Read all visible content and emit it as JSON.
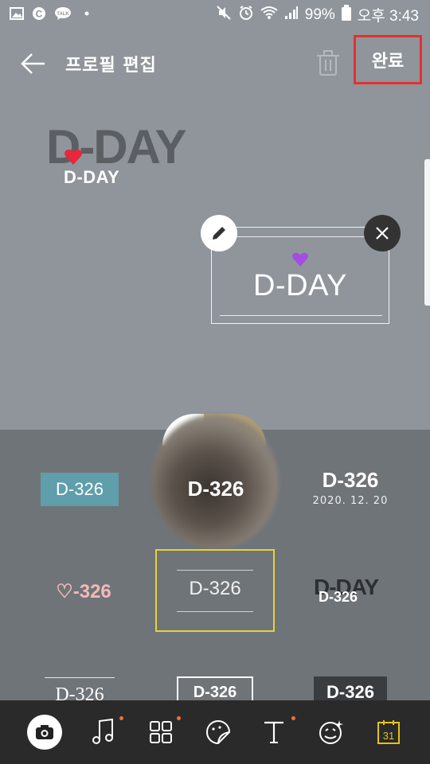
{
  "status_bar": {
    "battery": "99%",
    "time": "오후 3:43",
    "icons": [
      "gallery-icon",
      "c-app-icon",
      "talk-icon",
      "dot-icon",
      "mute-icon",
      "alarm-icon",
      "wifi-icon",
      "signal-icon",
      "battery-icon"
    ],
    "talk_label": "TALK"
  },
  "header": {
    "title": "프로필 편집",
    "done_label": "완료"
  },
  "canvas": {
    "dday_big": "D-DAY",
    "dday_small": "D-DAY",
    "selected_sticker_text": "D-DAY"
  },
  "stickers": {
    "s1": "D-326",
    "s2": "D-326",
    "s3_num": "D-326",
    "s3_date": "2020. 12. 20",
    "s4": "♡-326",
    "s5": "D-326",
    "s6_big": "D-DAY",
    "s6_small": "D-326",
    "s7": "D-326",
    "s8": "D-326",
    "s9": "D-326"
  },
  "toolbar": {
    "calendar_day": "31",
    "items": [
      "camera-icon",
      "music-icon",
      "grid-icon",
      "sticker-icon",
      "text-icon",
      "emoji-icon",
      "calendar-icon"
    ]
  },
  "colors": {
    "accent_red": "#e53030",
    "teal_sticker": "#5f9eab",
    "yellow_selected": "#e7d23a",
    "toolbar_bg": "#2a2a2a"
  }
}
